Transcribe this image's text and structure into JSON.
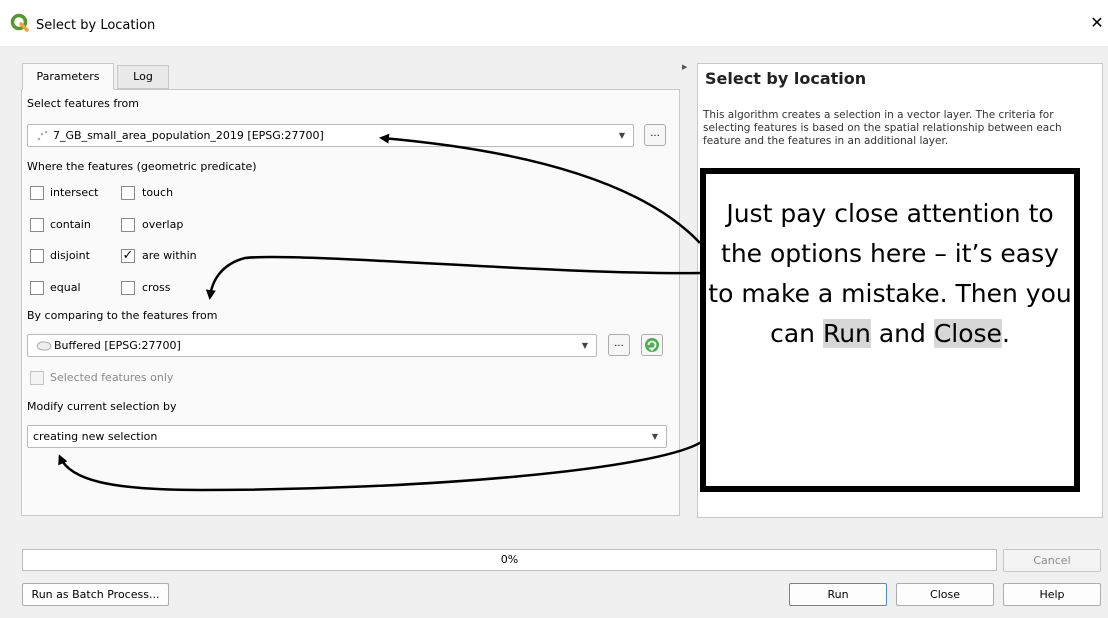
{
  "window": {
    "title": "Select by Location",
    "close_glyph": "✕"
  },
  "tabs": [
    {
      "label": "Parameters"
    },
    {
      "label": "Log"
    }
  ],
  "params": {
    "select_from_label": "Select features from",
    "input_layer": "7_GB_small_area_population_2019  [EPSG:27700]",
    "predicate_label": "Where the features (geometric predicate)",
    "predicates": [
      {
        "label": "intersect",
        "checked": false
      },
      {
        "label": "touch",
        "checked": false
      },
      {
        "label": "contain",
        "checked": false
      },
      {
        "label": "overlap",
        "checked": false
      },
      {
        "label": "disjoint",
        "checked": false
      },
      {
        "label": "are within",
        "checked": true
      },
      {
        "label": "equal",
        "checked": false
      },
      {
        "label": "cross",
        "checked": false
      }
    ],
    "compare_label": "By comparing to the features from",
    "compare_layer": "Buffered [EPSG:27700]",
    "selected_only_label": "Selected features only",
    "modify_label": "Modify current selection by",
    "modify_value": "creating new selection",
    "dots_label": "..."
  },
  "help": {
    "title": "Select by location",
    "body": "This algorithm creates a selection in a vector layer. The criteria for selecting features is based on the spatial relationship between each feature and the features in an additional layer."
  },
  "callout": {
    "text_before": "Just pay close attention to the options here – it’s easy to make a mistake. Then you can ",
    "run_word": "Run",
    "and_word": " and ",
    "close_word": "Close",
    "end": "."
  },
  "progress": {
    "percent": 0,
    "label": "0%"
  },
  "buttons": {
    "cancel": "Cancel",
    "batch": "Run as Batch Process...",
    "run": "Run",
    "close": "Close",
    "help": "Help"
  },
  "icons": {
    "app": "qgis-logo-icon",
    "point_layer": "point-layer-icon",
    "polygon_layer": "polygon-layer-icon",
    "iterate": "iterate-icon"
  },
  "colors": {
    "qgis_green": "#589632",
    "accent_blue": "#4a8ad8",
    "callout_border": "#000000"
  }
}
